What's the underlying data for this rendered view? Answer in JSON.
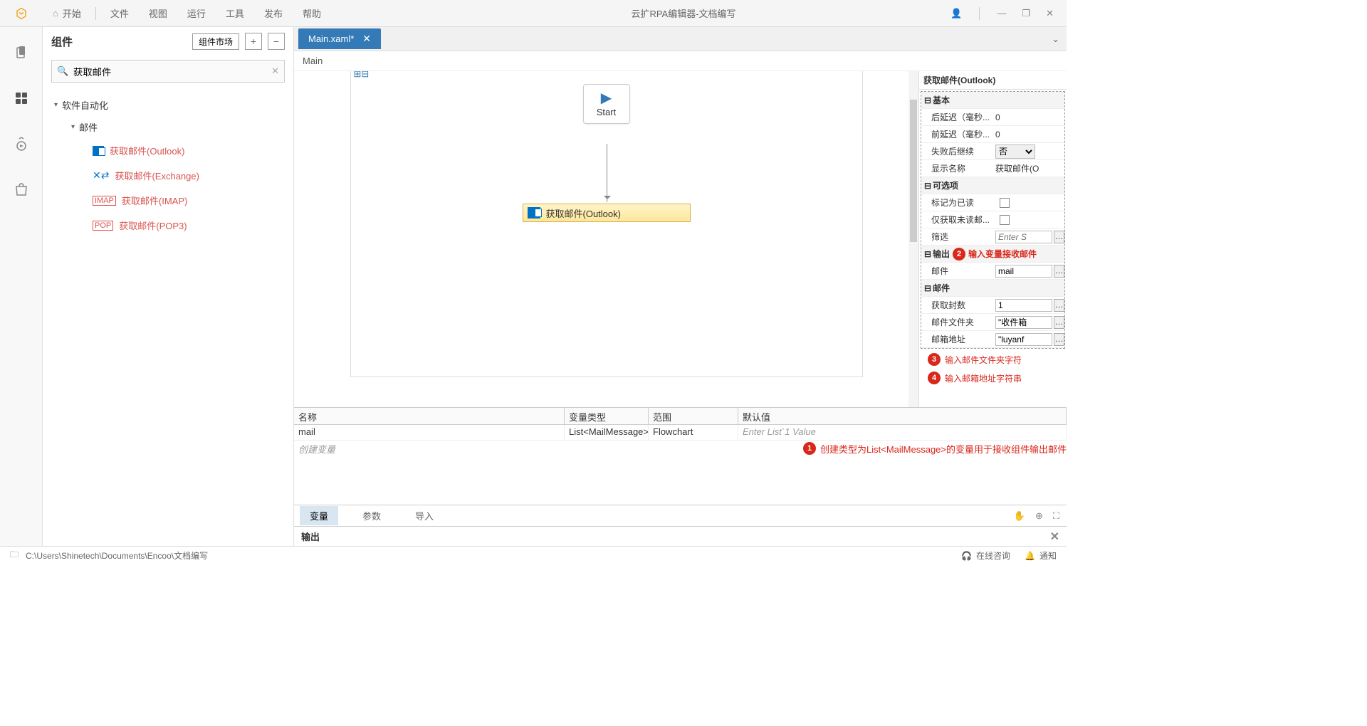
{
  "app": {
    "title": "云扩RPA编辑器-文档编写"
  },
  "menu": {
    "home": "开始",
    "file": "文件",
    "view": "视图",
    "run": "运行",
    "tool": "工具",
    "publish": "发布",
    "help": "帮助"
  },
  "sidebar": {
    "title": "组件",
    "market": "组件市场",
    "search_value": "获取邮件",
    "cat1": "软件自动化",
    "cat2": "邮件",
    "items": [
      "获取邮件(Outlook)",
      "获取邮件(Exchange)",
      "获取邮件(IMAP)",
      "获取邮件(POP3)"
    ]
  },
  "tab": {
    "name": "Main.xaml*"
  },
  "breadcrumb": "Main",
  "flow": {
    "start": "Start",
    "activity": "获取邮件(Outlook)"
  },
  "props": {
    "title": "获取邮件(Outlook)",
    "sec_basic": "基本",
    "post_delay": "后延迟（毫秒...",
    "post_delay_v": "0",
    "pre_delay": "前延迟（毫秒...",
    "pre_delay_v": "0",
    "on_fail": "失败后继续",
    "on_fail_v": "否",
    "disp": "显示名称",
    "disp_v": "获取邮件(O",
    "sec_opt": "可选项",
    "mark_read": "标记为已读",
    "unread_only": "仅获取未读邮...",
    "filter": "筛选",
    "filter_ph": "Enter S",
    "sec_out": "输出",
    "mail": "邮件",
    "mail_v": "mail",
    "sec_mail": "邮件",
    "count": "获取封数",
    "count_v": "1",
    "folder": "邮件文件夹",
    "folder_v": "\"收件箱",
    "addr": "邮箱地址",
    "addr_v": "\"luyanf"
  },
  "ann": {
    "a1": "创建类型为List<MailMessage>的变量用于接收组件输出邮件",
    "a2": "输入变量接收邮件",
    "a3": "输入邮件文件夹字符",
    "a4": "输入邮箱地址字符串"
  },
  "vars": {
    "h_name": "名称",
    "h_type": "变量类型",
    "h_scope": "范围",
    "h_def": "默认值",
    "r_name": "mail",
    "r_type": "List<MailMessage>",
    "r_scope": "Flowchart",
    "r_def_ph": "Enter List`1 Value",
    "create": "创建变量"
  },
  "btabs": {
    "var": "变量",
    "arg": "参数",
    "imp": "导入"
  },
  "output": "输出",
  "status": {
    "path": "C:\\Users\\Shinetech\\Documents\\Encoo\\文档编写",
    "consult": "在线咨询",
    "notify": "通知"
  }
}
